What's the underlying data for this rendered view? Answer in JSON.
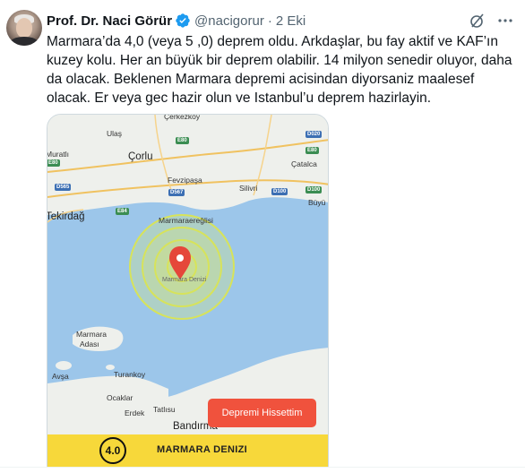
{
  "tweet": {
    "author_name": "Prof. Dr. Naci Görür",
    "handle": "@nacigorur",
    "separator": "·",
    "date": "2 Eki",
    "text": "Marmara’da 4,0 (veya 5 ,0) deprem oldu. Arkdaşlar, bu fay aktif ve KAF’ın kuzey kolu. Her an büyük bir deprem olabilir. 14 milyon senedir oluyor, daha da olacak. Beklenen Marmara depremi acisindan diyorsaniz maalesef olacak. Er veya gec hazir olun ve Istanbul’u deprem hazirlayin.",
    "verified_color": "#1d9bf0",
    "icons": {
      "verified": "verified-badge-icon",
      "grok": "grok-icon",
      "more": "more-dots-icon"
    }
  },
  "media": {
    "map_labels": {
      "cerkezkoy": "Çerkezköy",
      "ulas": "Ulaş",
      "muratli": "Muratlı",
      "corlu": "Çorlu",
      "catalca": "Çatalca",
      "fevzipasa": "Fevzipaşa",
      "silivri": "Silivri",
      "buyuk": "Büyü",
      "tekirdag": "Tekirdağ",
      "marmaraereglisi": "Marmaraereğlisi",
      "marmara_denizi_map": "Marmara Denizi",
      "marmara_adasi_line1": "Marmara",
      "marmara_adasi_line2": "Adası",
      "avsa": "Avşa",
      "turankoy": "Turankoy",
      "ocaklar": "Ocaklar",
      "erdek": "Erdek",
      "tatlisu": "Tatlısu",
      "bandirma": "Bandırma"
    },
    "road_signs": {
      "e80_top": "E80",
      "d020": "D020",
      "e80_mid": "E80",
      "e80_right": "E80",
      "d565": "D565",
      "d567": "D567",
      "d100_a": "D100",
      "d100_b": "D100",
      "e84": "E84"
    },
    "report_button_label": "Depremi Hissettim",
    "magnitude": "4.0",
    "region": "MARMARA DENIZI",
    "colors": {
      "sea": "#9cc6ea",
      "land": "#eef0ec",
      "ring": "#d7e35a",
      "pin": "#e5473a",
      "button": "#f0523d",
      "bar": "#f7d83a"
    }
  }
}
